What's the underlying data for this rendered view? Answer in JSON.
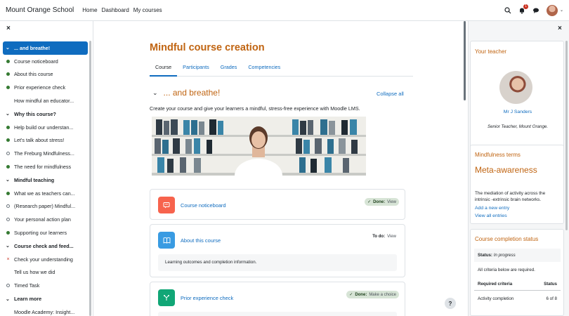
{
  "navbar": {
    "site_name": "Mount Orange School",
    "links": [
      "Home",
      "Dashboard",
      "My courses"
    ],
    "notification_count": "1"
  },
  "course_index": [
    {
      "type": "section",
      "label": "... and breathe!",
      "active": true
    },
    {
      "type": "item",
      "label": "Course noticeboard",
      "status": "done"
    },
    {
      "type": "item",
      "label": "About this course",
      "status": "done"
    },
    {
      "type": "item",
      "label": "Prior experience check",
      "status": "done"
    },
    {
      "type": "item",
      "label": "How mindful an educator...",
      "status": "none"
    },
    {
      "type": "section",
      "label": "Why this course?"
    },
    {
      "type": "item",
      "label": "Help build our understan...",
      "status": "done"
    },
    {
      "type": "item",
      "label": "Let's talk about stress!",
      "status": "done"
    },
    {
      "type": "item",
      "label": "The Freburg Mindfulness...",
      "status": "open"
    },
    {
      "type": "item",
      "label": "The need for mindfulness",
      "status": "done"
    },
    {
      "type": "section",
      "label": "Mindful teaching"
    },
    {
      "type": "item",
      "label": "What we as teachers can...",
      "status": "done"
    },
    {
      "type": "item",
      "label": "(Research paper) Mindful...",
      "status": "open"
    },
    {
      "type": "item",
      "label": "Your personal action plan",
      "status": "open"
    },
    {
      "type": "item",
      "label": "Supporting our learners",
      "status": "done"
    },
    {
      "type": "section",
      "label": "Course check and feed..."
    },
    {
      "type": "item",
      "label": "Check your understanding",
      "status": "fail"
    },
    {
      "type": "item",
      "label": "Tell us how we did",
      "status": "none"
    },
    {
      "type": "item",
      "label": "Timed Task",
      "status": "open"
    },
    {
      "type": "section",
      "label": "Learn more"
    },
    {
      "type": "item",
      "label": "Moodle Academy: Insight...",
      "status": "none"
    }
  ],
  "main": {
    "course_title": "Mindful course creation",
    "tabs": [
      "Course",
      "Participants",
      "Grades",
      "Competencies"
    ],
    "section_title": "... and breathe!",
    "collapse_all": "Collapse all",
    "section_summary": "Create your course and give your learners a mindful, stress-free experience with Moodle LMS.",
    "activities": [
      {
        "name": "Course noticeboard",
        "icon": "forum-icon",
        "color": "#f7634d",
        "completion_label": "Done:",
        "completion_sub": "View",
        "state": "done"
      },
      {
        "name": "About this course",
        "icon": "book-icon",
        "color": "#399be2",
        "completion_label": "To do:",
        "completion_sub": "View",
        "state": "todo",
        "description": "Learning outcomes and completion information."
      },
      {
        "name": "Prior experience check",
        "icon": "choice-icon",
        "color": "#11a676",
        "completion_label": "Done:",
        "completion_sub": "Make a choice",
        "state": "done"
      }
    ],
    "help": "?"
  },
  "blocks": {
    "teacher": {
      "title": "Your teacher",
      "name": "Mr J Sanders",
      "role": "Senior Teacher, Mount Orange."
    },
    "terms": {
      "title": "Mindfulness terms",
      "term": "Meta-awareness",
      "definition": "The mediation of activity across the intrinsic -extrinsic brain networks.",
      "add": "Add a new entry",
      "view": "View all entries"
    },
    "completion": {
      "title": "Course completion status",
      "status_label": "Status:",
      "status_value": "In progress",
      "criteria_note": "All criteria below are required.",
      "head_left": "Required criteria",
      "head_right": "Status",
      "row_left": "Activity completion",
      "row_right": "6 of 8"
    }
  },
  "colors": {
    "accent": "#0f6cbf",
    "brand": "#c06411",
    "done": "#357a32"
  }
}
